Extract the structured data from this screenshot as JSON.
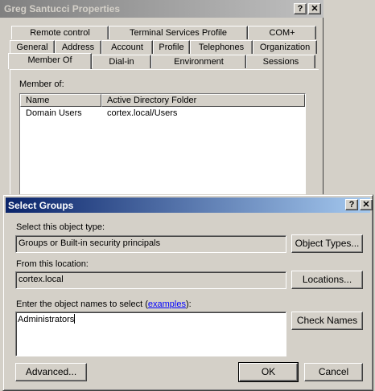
{
  "properties_window": {
    "title": "Greg Santucci Properties",
    "help_btn": "?",
    "close_btn": "✕",
    "tab_rows": [
      [
        "Remote control",
        "Terminal Services Profile",
        "COM+"
      ],
      [
        "General",
        "Address",
        "Account",
        "Profile",
        "Telephones",
        "Organization"
      ],
      [
        "Member Of",
        "Dial-in",
        "Environment",
        "Sessions"
      ]
    ],
    "member_of_label": "Member of:",
    "columns": [
      "Name",
      "Active Directory Folder"
    ],
    "rows": [
      {
        "name": "Domain Users",
        "folder": "cortex.local/Users"
      }
    ]
  },
  "select_groups": {
    "title": "Select Groups",
    "help_btn": "?",
    "close_btn": "✕",
    "object_type_label": "Select this object type:",
    "object_type_value": "Groups or Built-in security principals",
    "object_types_button": "Object Types...",
    "location_label": "From this location:",
    "location_value": "cortex.local",
    "locations_button": "Locations...",
    "names_label_prefix": "Enter the object names to select (",
    "names_label_link": "examples",
    "names_label_suffix": "):",
    "names_value": "Administrators",
    "check_names_button": "Check Names",
    "advanced_button": "Advanced...",
    "ok_button": "OK",
    "cancel_button": "Cancel"
  }
}
